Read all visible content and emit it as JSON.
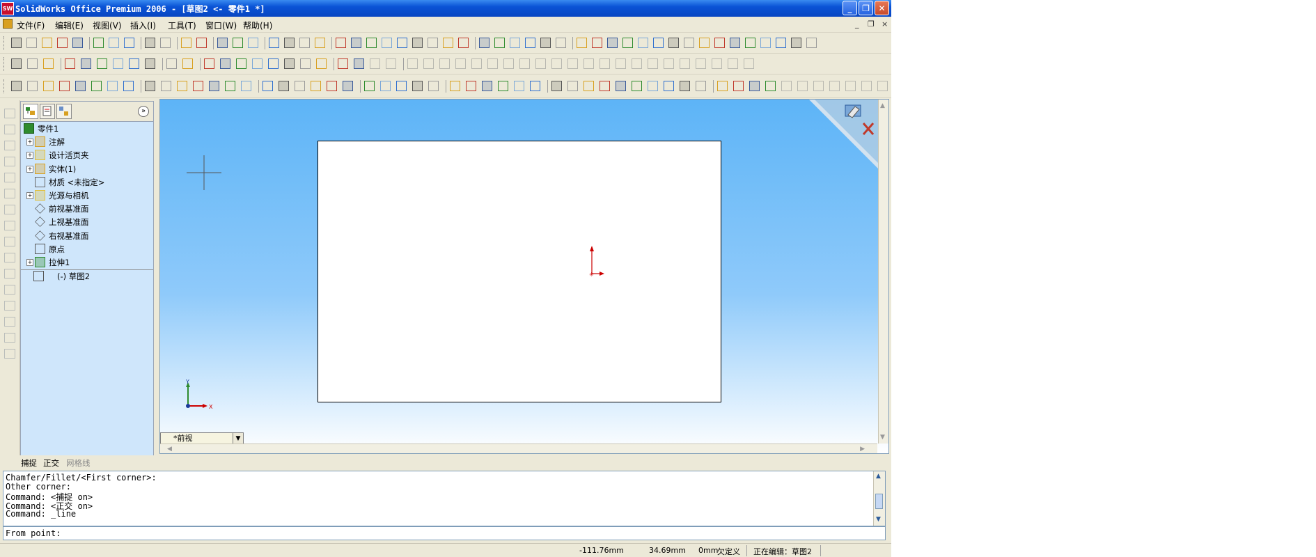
{
  "window": {
    "title": "SolidWorks Office Premium 2006 - [草图2 <- 零件1 *]",
    "app_icon_text": "SW",
    "minimize_glyph": "_",
    "maximize_glyph": "❐",
    "close_glyph": "✕"
  },
  "menubar": {
    "items": [
      "文件(F)",
      "编辑(E)",
      "视图(V)",
      "插入(I)",
      "工具(T)",
      "窗口(W)",
      "帮助(H)"
    ],
    "mdi_controls": [
      "_",
      "❐",
      "×"
    ]
  },
  "feature_tree": {
    "tabs": [
      "featuremanager-tab",
      "propertymanager-tab",
      "configurationmanager-tab"
    ],
    "collapse_glyph": "»",
    "root": "零件1",
    "items": [
      {
        "label": "注解",
        "expandable": true,
        "icon": "annotations-icon"
      },
      {
        "label": "设计活页夹",
        "expandable": true,
        "icon": "design-binder-icon"
      },
      {
        "label": "实体(1)",
        "expandable": true,
        "icon": "solid-bodies-icon"
      },
      {
        "label": "材质 <未指定>",
        "expandable": false,
        "icon": "material-icon"
      },
      {
        "label": "光源与相机",
        "expandable": true,
        "icon": "lights-cameras-icon"
      },
      {
        "label": "前视基准面",
        "expandable": false,
        "icon": "plane-icon"
      },
      {
        "label": "上视基准面",
        "expandable": false,
        "icon": "plane-icon"
      },
      {
        "label": "右视基准面",
        "expandable": false,
        "icon": "plane-icon"
      },
      {
        "label": "原点",
        "expandable": false,
        "icon": "origin-icon"
      },
      {
        "label": "拉伸1",
        "expandable": true,
        "icon": "extrude-icon"
      },
      {
        "label": "(-) 草图2",
        "expandable": false,
        "icon": "sketch-icon"
      }
    ]
  },
  "graphics": {
    "view_combo": "*前视",
    "axis_x_label": "X",
    "axis_y_label": "Y",
    "background_top": "#5db4f7",
    "background_bottom": "#ffffff"
  },
  "mode_strip": {
    "snap": "捕捉",
    "ortho": "正交",
    "grid": "网格线"
  },
  "command": {
    "history": [
      "Chamfer/Fillet/<First corner>:",
      "Other corner:",
      "Command: <捕捉 on>",
      "Command: <正交 on>",
      "Command: _line"
    ],
    "prompt": "From point:"
  },
  "statusbar": {
    "x": "-111.76mm",
    "y": "34.69mm",
    "z": "0mm",
    "definition": "欠定义",
    "editing": "正在编辑：草图2"
  },
  "colors": {
    "titlebar": "#0a53d6",
    "chrome": "#ece9d8",
    "tree_bg": "#cfe6fb",
    "origin_red": "#cc0000"
  }
}
